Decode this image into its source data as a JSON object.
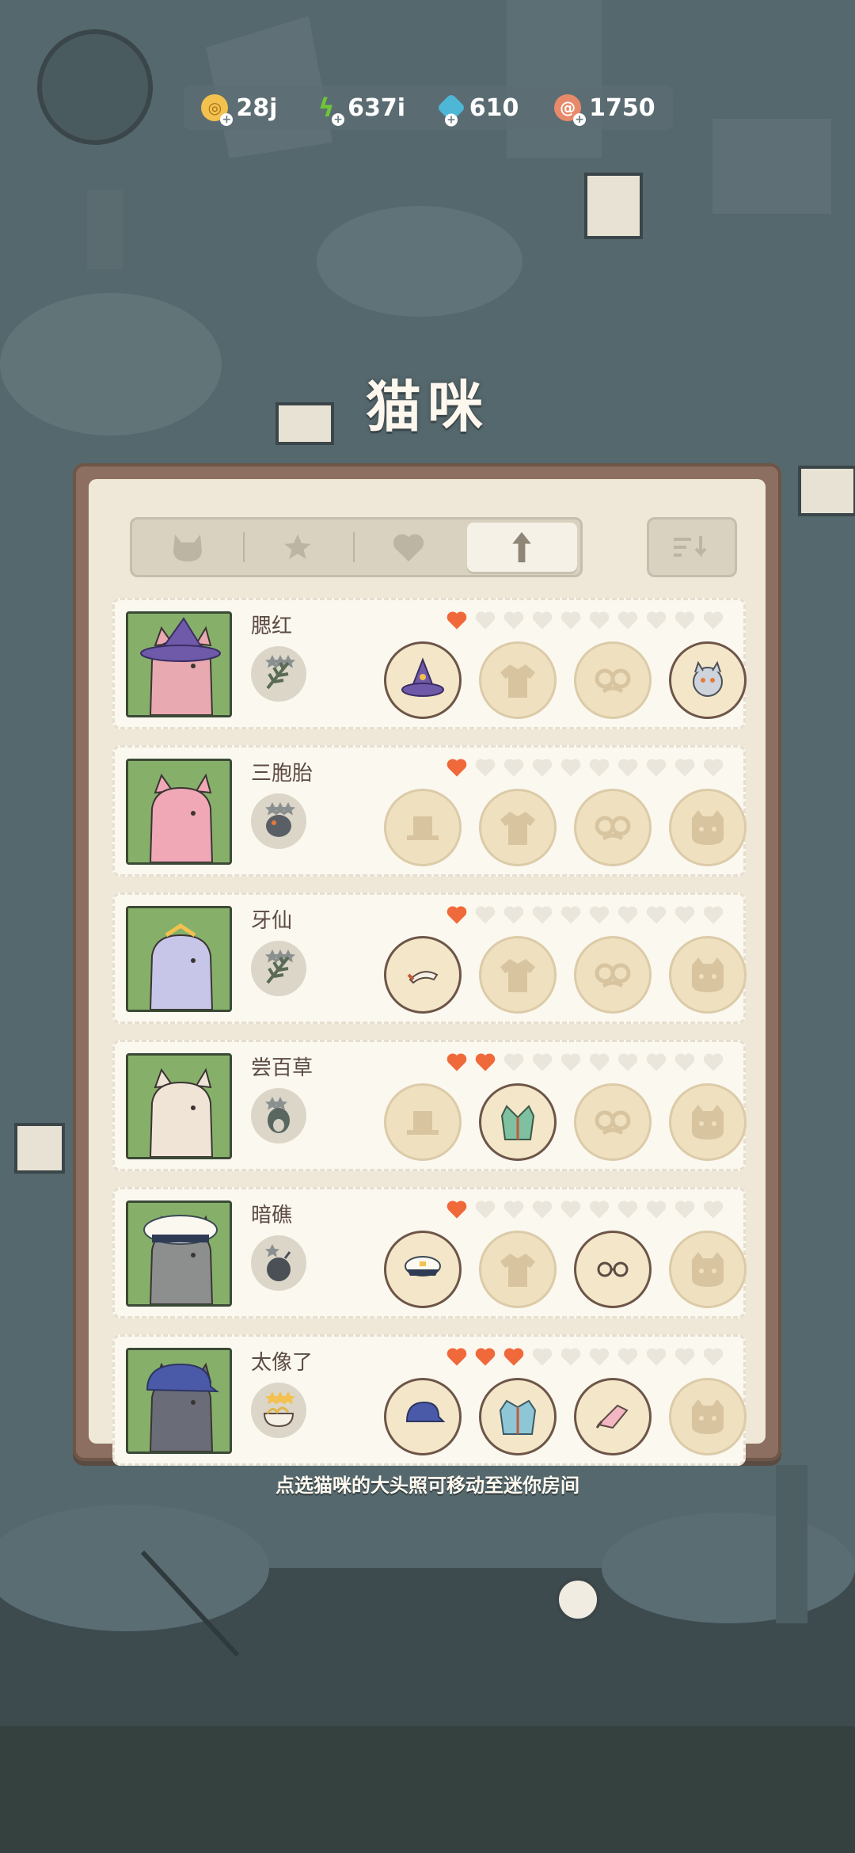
{
  "currency": [
    {
      "icon": "coin-icon",
      "value": "28j",
      "color": "#f2c14e"
    },
    {
      "icon": "lightning-icon",
      "value": "637i",
      "color": "#6fc43a"
    },
    {
      "icon": "gem-icon",
      "value": "610",
      "color": "#4fb7d6"
    },
    {
      "icon": "fish-cake-icon",
      "value": "1750",
      "color": "#e88a6a"
    }
  ],
  "title": "猫咪",
  "tabs": [
    {
      "icon": "cat-face-icon"
    },
    {
      "icon": "star-icon"
    },
    {
      "icon": "heart-icon"
    },
    {
      "icon": "arrow-up-icon",
      "active": true
    }
  ],
  "sort_button": {
    "icon": "sort-icon"
  },
  "cats": [
    {
      "name": "腮红",
      "hearts": 1,
      "badge": "herb-3star-icon",
      "slots": [
        "witch-hat-icon",
        "shirt-placeholder-icon",
        "glasses-placeholder-icon",
        "cat-toy-icon"
      ],
      "portrait_color": "#e9a9b0"
    },
    {
      "name": "三胞胎",
      "hearts": 1,
      "badge": "fish-3star-icon",
      "slots": [
        "hat-placeholder-icon",
        "shirt-placeholder-icon",
        "glasses-placeholder-icon",
        "item-placeholder-icon"
      ],
      "portrait_color": "#f0a8b6"
    },
    {
      "name": "牙仙",
      "hearts": 1,
      "badge": "herb-3star-icon",
      "slots": [
        "horn-icon",
        "shirt-placeholder-icon",
        "glasses-placeholder-icon",
        "item-placeholder-icon"
      ],
      "portrait_color": "#c7c6e8"
    },
    {
      "name": "尝百草",
      "hearts": 2,
      "badge": "bean-2star-icon",
      "slots": [
        "hat-placeholder-icon",
        "green-vest-icon",
        "glasses-placeholder-icon",
        "item-placeholder-icon"
      ],
      "portrait_color": "#efe4d6"
    },
    {
      "name": "暗礁",
      "hearts": 1,
      "badge": "bomb-1star-icon",
      "slots": [
        "captain-hat-icon",
        "shirt-placeholder-icon",
        "round-glasses-icon",
        "item-placeholder-icon"
      ],
      "portrait_color": "#8d8f8e"
    },
    {
      "name": "太像了",
      "hearts": 3,
      "badge": "noodles-3star-icon",
      "slots": [
        "blue-cap-icon",
        "jacket-icon",
        "fish-item-icon",
        "item-placeholder-icon"
      ],
      "portrait_color": "#6a6d78"
    }
  ],
  "max_hearts": 10,
  "hint": "点选猫咪的大头照可移动至迷你房间",
  "colors": {
    "heart_filled": "#f0693a",
    "heart_empty": "#ebe6dc"
  }
}
